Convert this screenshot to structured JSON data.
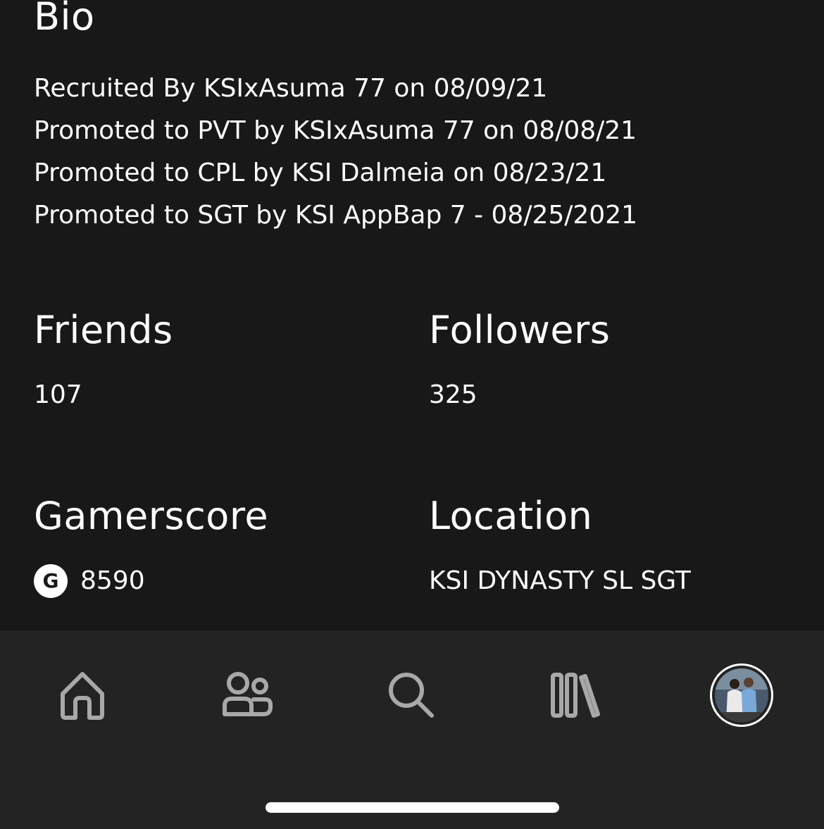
{
  "bio": {
    "heading": "Bio",
    "lines": [
      "Recruited By KSIxAsuma 77 on 08/09/21",
      "Promoted to PVT by KSIxAsuma 77 on 08/08/21",
      "Promoted to CPL by KSI Dalmeia on 08/23/21",
      "Promoted to SGT by KSI AppBap 7 - 08/25/2021"
    ]
  },
  "stats": {
    "friends": {
      "label": "Friends",
      "value": "107"
    },
    "followers": {
      "label": "Followers",
      "value": "325"
    },
    "gamerscore": {
      "label": "Gamerscore",
      "icon": "gamerscore-g-icon",
      "icon_glyph": "G",
      "value": "8590"
    },
    "location": {
      "label": "Location",
      "value": "KSI DYNASTY SL SGT"
    }
  },
  "tabbar": {
    "items": [
      {
        "name": "home",
        "icon": "home-icon"
      },
      {
        "name": "social",
        "icon": "people-icon"
      },
      {
        "name": "search",
        "icon": "search-icon"
      },
      {
        "name": "library",
        "icon": "library-icon"
      },
      {
        "name": "profile",
        "icon": "avatar",
        "selected": true
      }
    ]
  },
  "colors": {
    "background": "#181818",
    "tabbar_background": "#232323",
    "text": "#ffffff",
    "icon_inactive": "#a8a8a8"
  }
}
